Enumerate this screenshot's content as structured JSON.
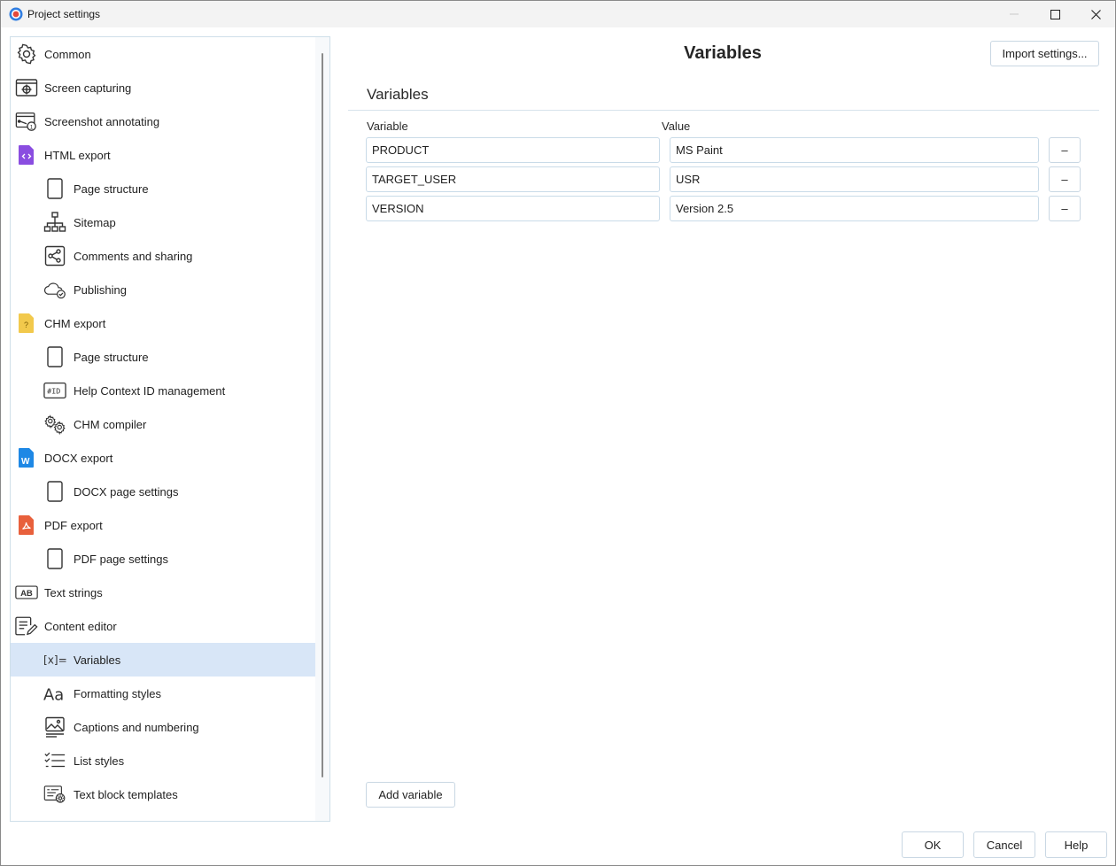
{
  "window": {
    "title": "Project settings"
  },
  "colors": {
    "accent": "#d8e6f7",
    "html": "#8a4de0",
    "chm": "#f2c94c",
    "docx": "#1e88e5",
    "pdf": "#e8603c"
  },
  "sidebar": {
    "items": [
      {
        "label": "Common",
        "icon": "gear-icon"
      },
      {
        "label": "Screen capturing",
        "icon": "screen-capture-icon"
      },
      {
        "label": "Screenshot annotating",
        "icon": "screenshot-annotate-icon"
      },
      {
        "label": "HTML export",
        "icon": "html-file-icon"
      },
      {
        "label": "Page structure",
        "icon": "page-icon"
      },
      {
        "label": "Sitemap",
        "icon": "sitemap-icon"
      },
      {
        "label": "Comments and sharing",
        "icon": "share-icon"
      },
      {
        "label": "Publishing",
        "icon": "cloud-check-icon"
      },
      {
        "label": "CHM export",
        "icon": "chm-file-icon"
      },
      {
        "label": "Page structure",
        "icon": "page-icon"
      },
      {
        "label": "Help Context ID management",
        "icon": "id-tag-icon"
      },
      {
        "label": "CHM compiler",
        "icon": "gears-icon"
      },
      {
        "label": "DOCX export",
        "icon": "docx-file-icon"
      },
      {
        "label": "DOCX page settings",
        "icon": "page-icon"
      },
      {
        "label": "PDF export",
        "icon": "pdf-file-icon"
      },
      {
        "label": "PDF page settings",
        "icon": "page-icon"
      },
      {
        "label": "Text strings",
        "icon": "ab-box-icon"
      },
      {
        "label": "Content editor",
        "icon": "edit-document-icon"
      },
      {
        "label": "Variables",
        "icon": "variable-icon"
      },
      {
        "label": "Formatting styles",
        "icon": "font-style-icon"
      },
      {
        "label": "Captions and numbering",
        "icon": "image-caption-icon"
      },
      {
        "label": "List styles",
        "icon": "checklist-icon"
      },
      {
        "label": "Text block templates",
        "icon": "template-gear-icon"
      }
    ],
    "id_glyph": "#ID",
    "ab_glyph": "AB",
    "font_glyph": "Aa",
    "var_glyph": "[x]="
  },
  "main": {
    "title": "Variables",
    "import_label": "Import settings...",
    "section_title": "Variables",
    "col_variable": "Variable",
    "col_value": "Value",
    "rows": [
      {
        "name": "PRODUCT",
        "value": "MS Paint",
        "remove": "–"
      },
      {
        "name": "TARGET_USER",
        "value": "USR",
        "remove": "–"
      },
      {
        "name": "VERSION",
        "value": "Version 2.5",
        "remove": "–"
      }
    ],
    "add_label": "Add variable"
  },
  "footer": {
    "ok": "OK",
    "cancel": "Cancel",
    "help": "Help"
  }
}
